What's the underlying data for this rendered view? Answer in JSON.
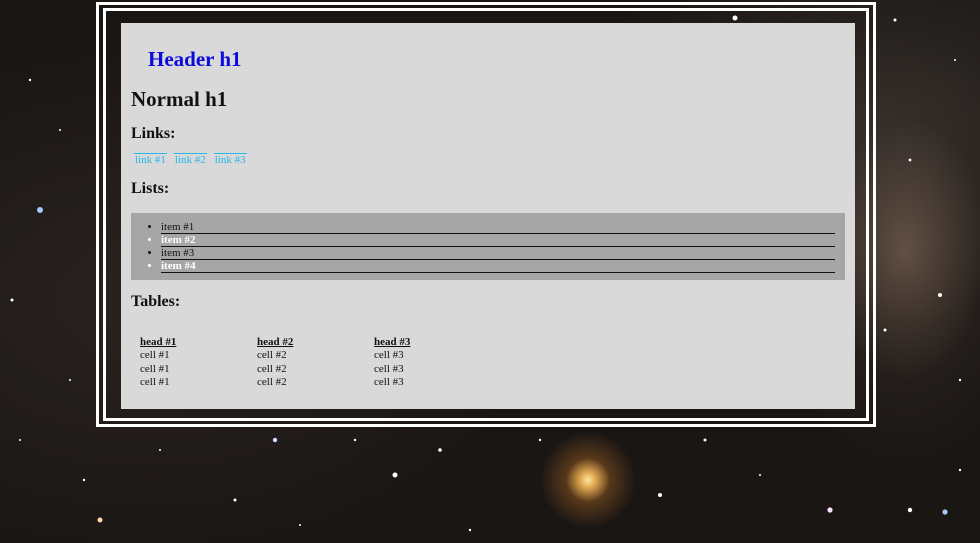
{
  "page": {
    "header_h1": "Header h1",
    "normal_h1": "Normal h1"
  },
  "links_section": {
    "title": "Links:",
    "links": [
      "link #1",
      "link #2",
      "link #3"
    ]
  },
  "lists_section": {
    "title": "Lists:",
    "items": [
      "item #1",
      "item #2",
      "item #3",
      "item #4"
    ]
  },
  "tables_section": {
    "title": "Tables:",
    "headers": [
      "head #1",
      "head #2",
      "head #3"
    ],
    "rows": [
      [
        "cell #1",
        "cell #2",
        "cell #3"
      ],
      [
        "cell #1",
        "cell #2",
        "cell #3"
      ],
      [
        "cell #1",
        "cell #2",
        "cell #3"
      ]
    ]
  },
  "colors": {
    "header_h1": "#0b0bdc",
    "link": "#27b6e8",
    "panel_bg": "#d9d9d9",
    "list_bg": "#a6a6a6"
  }
}
